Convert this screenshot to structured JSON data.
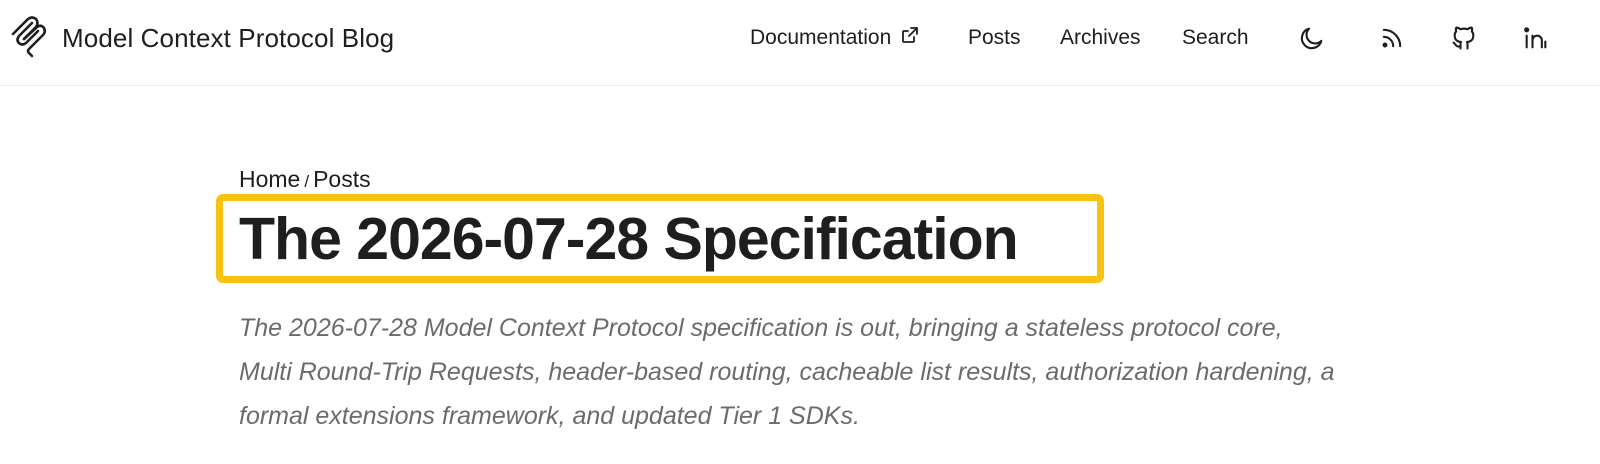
{
  "header": {
    "site_title": "Model Context Protocol Blog",
    "nav": {
      "documentation": "Documentation",
      "posts": "Posts",
      "archives": "Archives",
      "search": "Search"
    },
    "icons": {
      "logo": "mcp-logo-icon",
      "external": "external-link-icon",
      "theme": "moon-icon",
      "rss": "rss-icon",
      "github": "github-icon",
      "linkedin": "linkedin-icon"
    }
  },
  "breadcrumb": {
    "home": "Home",
    "separator": "/",
    "posts": "Posts"
  },
  "post": {
    "title": "The 2026-07-28 Specification",
    "description": "The 2026-07-28 Model Context Protocol specification is out, bringing a stateless protocol core, Multi Round-Trip Requests, header-based routing, cacheable list results, authorization hardening, a formal extensions framework, and updated Tier 1 SDKs."
  },
  "colors": {
    "highlight": "#f8c213",
    "text": "#1e1e1e",
    "description": "#6b6b6b"
  }
}
